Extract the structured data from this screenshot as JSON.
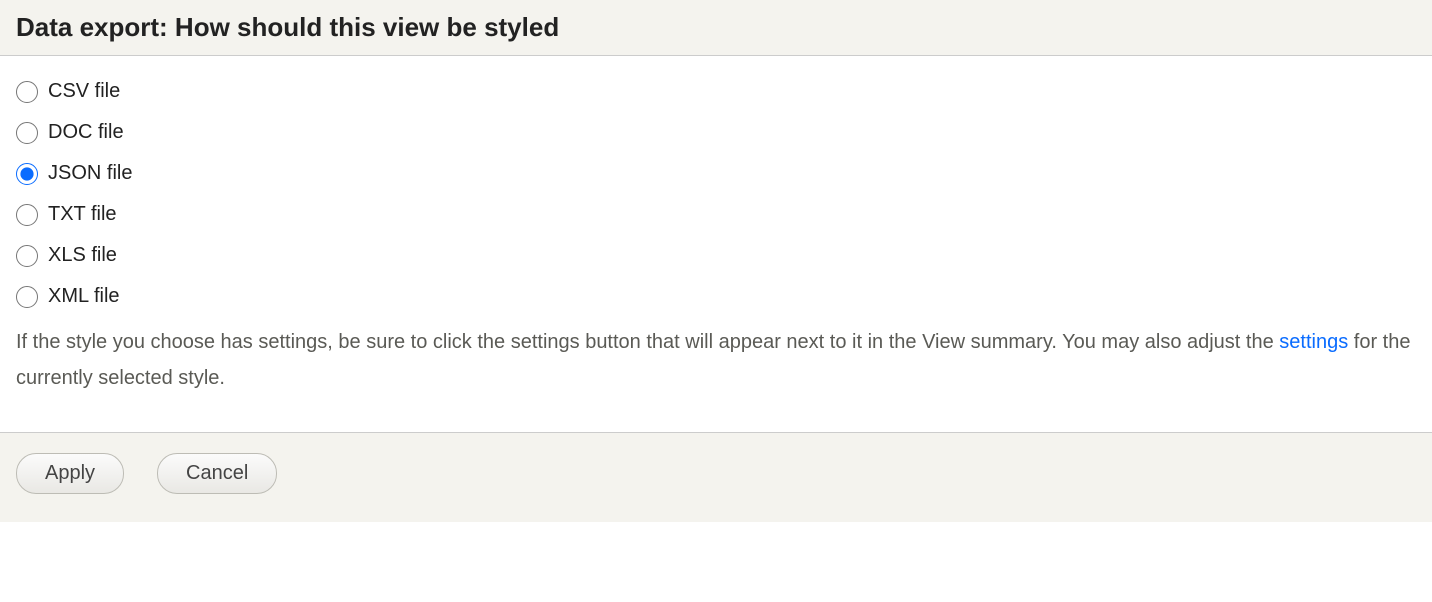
{
  "header": {
    "title": "Data export: How should this view be styled"
  },
  "options": [
    {
      "label": "CSV file",
      "checked": false
    },
    {
      "label": "DOC file",
      "checked": false
    },
    {
      "label": "JSON file",
      "checked": true
    },
    {
      "label": "TXT file",
      "checked": false
    },
    {
      "label": "XLS file",
      "checked": false
    },
    {
      "label": "XML file",
      "checked": false
    }
  ],
  "help": {
    "text_before": "If the style you choose has settings, be sure to click the settings button that will appear next to it in the View summary. You may also adjust the ",
    "link_text": "settings",
    "text_after": " for the currently selected style."
  },
  "footer": {
    "apply_label": "Apply",
    "cancel_label": "Cancel"
  }
}
